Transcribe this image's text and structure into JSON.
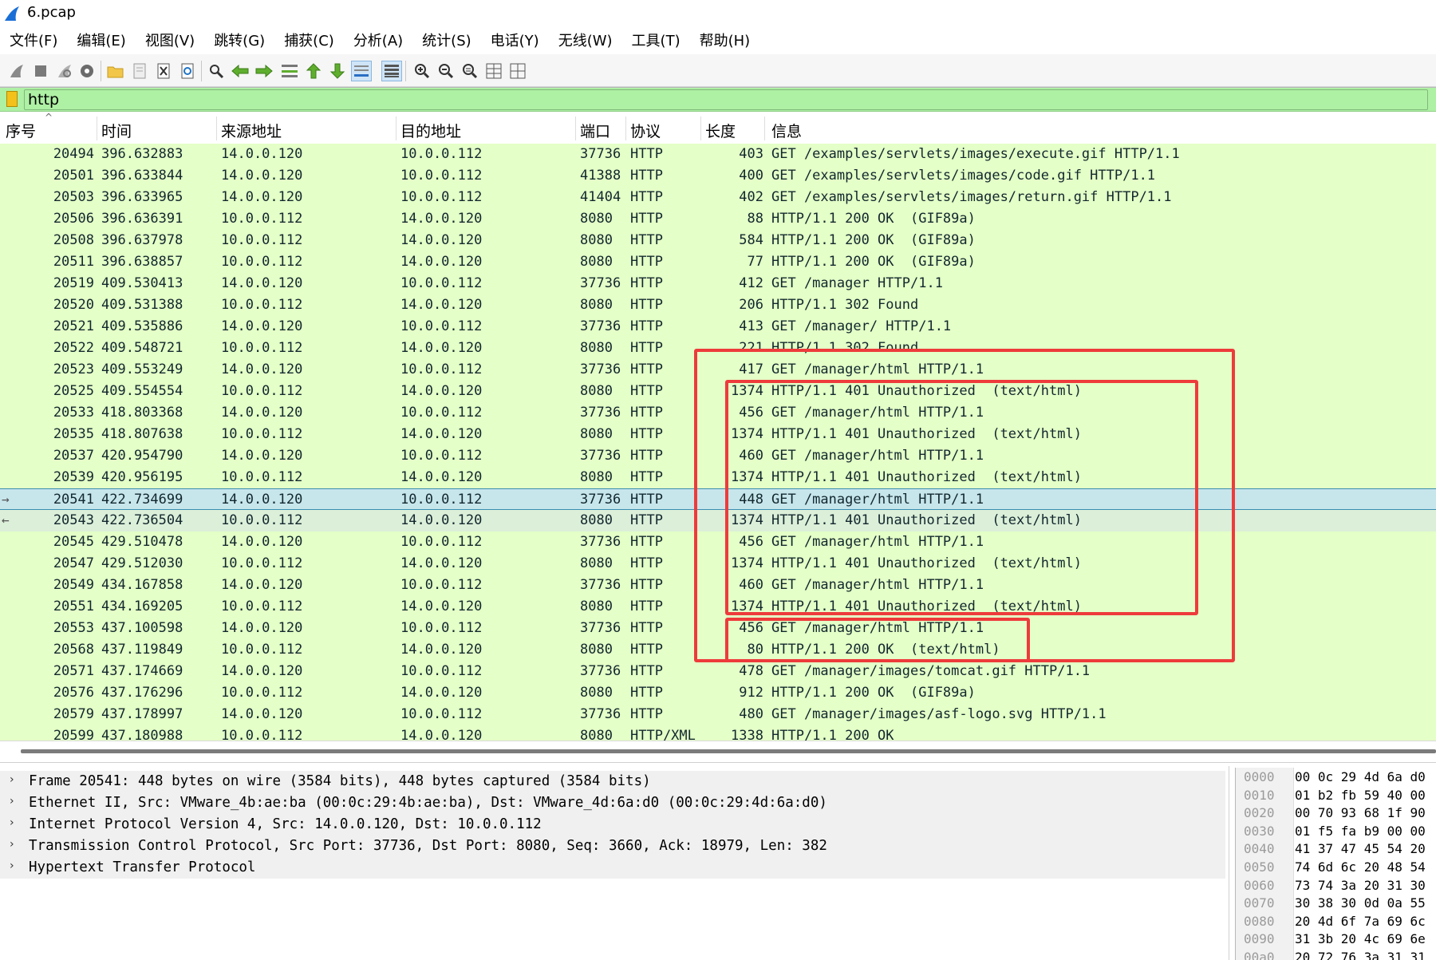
{
  "window": {
    "title": "6.pcap",
    "icon": "wireshark-fin-icon"
  },
  "menu": [
    "文件(F)",
    "编辑(E)",
    "视图(V)",
    "跳转(G)",
    "捕获(C)",
    "分析(A)",
    "统计(S)",
    "电话(Y)",
    "无线(W)",
    "工具(T)",
    "帮助(H)"
  ],
  "toolbar": {
    "icons": [
      "start-capture-icon",
      "stop-capture-icon",
      "restart-capture-icon",
      "capture-options-icon",
      "open-file-icon",
      "save-file-icon",
      "close-file-icon",
      "reload-file-icon",
      "find-packet-icon",
      "go-back-icon",
      "go-forward-icon",
      "go-to-packet-icon",
      "first-packet-icon",
      "last-packet-icon",
      "autoscroll-icon",
      "colorize-icon",
      "zoom-in-icon",
      "zoom-out-icon",
      "normal-size-icon",
      "resize-columns-icon",
      "layout-icon"
    ]
  },
  "filter": {
    "value": "http"
  },
  "columns": [
    "序号",
    "时间",
    "来源地址",
    "目的地址",
    "端口",
    "协议",
    "长度",
    "信息"
  ],
  "packets": [
    {
      "no": "20494",
      "time": "396.632883",
      "src": "14.0.0.120",
      "dst": "10.0.0.112",
      "port": "37736",
      "proto": "HTTP",
      "len": "403",
      "info": "GET /examples/servlets/images/execute.gif HTTP/1.1"
    },
    {
      "no": "20501",
      "time": "396.633844",
      "src": "14.0.0.120",
      "dst": "10.0.0.112",
      "port": "41388",
      "proto": "HTTP",
      "len": "400",
      "info": "GET /examples/servlets/images/code.gif HTTP/1.1"
    },
    {
      "no": "20503",
      "time": "396.633965",
      "src": "14.0.0.120",
      "dst": "10.0.0.112",
      "port": "41404",
      "proto": "HTTP",
      "len": "402",
      "info": "GET /examples/servlets/images/return.gif HTTP/1.1"
    },
    {
      "no": "20506",
      "time": "396.636391",
      "src": "10.0.0.112",
      "dst": "14.0.0.120",
      "port": "8080",
      "proto": "HTTP",
      "len": "88",
      "info": "HTTP/1.1 200 OK  (GIF89a)"
    },
    {
      "no": "20508",
      "time": "396.637978",
      "src": "10.0.0.112",
      "dst": "14.0.0.120",
      "port": "8080",
      "proto": "HTTP",
      "len": "584",
      "info": "HTTP/1.1 200 OK  (GIF89a)"
    },
    {
      "no": "20511",
      "time": "396.638857",
      "src": "10.0.0.112",
      "dst": "14.0.0.120",
      "port": "8080",
      "proto": "HTTP",
      "len": "77",
      "info": "HTTP/1.1 200 OK  (GIF89a)"
    },
    {
      "no": "20519",
      "time": "409.530413",
      "src": "14.0.0.120",
      "dst": "10.0.0.112",
      "port": "37736",
      "proto": "HTTP",
      "len": "412",
      "info": "GET /manager HTTP/1.1"
    },
    {
      "no": "20520",
      "time": "409.531388",
      "src": "10.0.0.112",
      "dst": "14.0.0.120",
      "port": "8080",
      "proto": "HTTP",
      "len": "206",
      "info": "HTTP/1.1 302 Found"
    },
    {
      "no": "20521",
      "time": "409.535886",
      "src": "14.0.0.120",
      "dst": "10.0.0.112",
      "port": "37736",
      "proto": "HTTP",
      "len": "413",
      "info": "GET /manager/ HTTP/1.1"
    },
    {
      "no": "20522",
      "time": "409.548721",
      "src": "10.0.0.112",
      "dst": "14.0.0.120",
      "port": "8080",
      "proto": "HTTP",
      "len": "221",
      "info": "HTTP/1.1 302 Found"
    },
    {
      "no": "20523",
      "time": "409.553249",
      "src": "14.0.0.120",
      "dst": "10.0.0.112",
      "port": "37736",
      "proto": "HTTP",
      "len": "417",
      "info": "GET /manager/html HTTP/1.1"
    },
    {
      "no": "20525",
      "time": "409.554554",
      "src": "10.0.0.112",
      "dst": "14.0.0.120",
      "port": "8080",
      "proto": "HTTP",
      "len": "1374",
      "info": "HTTP/1.1 401 Unauthorized  (text/html)"
    },
    {
      "no": "20533",
      "time": "418.803368",
      "src": "14.0.0.120",
      "dst": "10.0.0.112",
      "port": "37736",
      "proto": "HTTP",
      "len": "456",
      "info": "GET /manager/html HTTP/1.1"
    },
    {
      "no": "20535",
      "time": "418.807638",
      "src": "10.0.0.112",
      "dst": "14.0.0.120",
      "port": "8080",
      "proto": "HTTP",
      "len": "1374",
      "info": "HTTP/1.1 401 Unauthorized  (text/html)"
    },
    {
      "no": "20537",
      "time": "420.954790",
      "src": "14.0.0.120",
      "dst": "10.0.0.112",
      "port": "37736",
      "proto": "HTTP",
      "len": "460",
      "info": "GET /manager/html HTTP/1.1"
    },
    {
      "no": "20539",
      "time": "420.956195",
      "src": "10.0.0.112",
      "dst": "14.0.0.120",
      "port": "8080",
      "proto": "HTTP",
      "len": "1374",
      "info": "HTTP/1.1 401 Unauthorized  (text/html)"
    },
    {
      "no": "20541",
      "time": "422.734699",
      "src": "14.0.0.120",
      "dst": "10.0.0.112",
      "port": "37736",
      "proto": "HTTP",
      "len": "448",
      "info": "GET /manager/html HTTP/1.1",
      "state": "selected",
      "mark": "→"
    },
    {
      "no": "20543",
      "time": "422.736504",
      "src": "10.0.0.112",
      "dst": "14.0.0.120",
      "port": "8080",
      "proto": "HTTP",
      "len": "1374",
      "info": "HTTP/1.1 401 Unauthorized  (text/html)",
      "state": "related",
      "mark": "←"
    },
    {
      "no": "20545",
      "time": "429.510478",
      "src": "14.0.0.120",
      "dst": "10.0.0.112",
      "port": "37736",
      "proto": "HTTP",
      "len": "456",
      "info": "GET /manager/html HTTP/1.1"
    },
    {
      "no": "20547",
      "time": "429.512030",
      "src": "10.0.0.112",
      "dst": "14.0.0.120",
      "port": "8080",
      "proto": "HTTP",
      "len": "1374",
      "info": "HTTP/1.1 401 Unauthorized  (text/html)"
    },
    {
      "no": "20549",
      "time": "434.167858",
      "src": "14.0.0.120",
      "dst": "10.0.0.112",
      "port": "37736",
      "proto": "HTTP",
      "len": "460",
      "info": "GET /manager/html HTTP/1.1"
    },
    {
      "no": "20551",
      "time": "434.169205",
      "src": "10.0.0.112",
      "dst": "14.0.0.120",
      "port": "8080",
      "proto": "HTTP",
      "len": "1374",
      "info": "HTTP/1.1 401 Unauthorized  (text/html)"
    },
    {
      "no": "20553",
      "time": "437.100598",
      "src": "14.0.0.120",
      "dst": "10.0.0.112",
      "port": "37736",
      "proto": "HTTP",
      "len": "456",
      "info": "GET /manager/html HTTP/1.1"
    },
    {
      "no": "20568",
      "time": "437.119849",
      "src": "10.0.0.112",
      "dst": "14.0.0.120",
      "port": "8080",
      "proto": "HTTP",
      "len": "80",
      "info": "HTTP/1.1 200 OK  (text/html)"
    },
    {
      "no": "20571",
      "time": "437.174669",
      "src": "14.0.0.120",
      "dst": "10.0.0.112",
      "port": "37736",
      "proto": "HTTP",
      "len": "478",
      "info": "GET /manager/images/tomcat.gif HTTP/1.1"
    },
    {
      "no": "20576",
      "time": "437.176296",
      "src": "10.0.0.112",
      "dst": "14.0.0.120",
      "port": "8080",
      "proto": "HTTP",
      "len": "912",
      "info": "HTTP/1.1 200 OK  (GIF89a)"
    },
    {
      "no": "20579",
      "time": "437.178997",
      "src": "14.0.0.120",
      "dst": "10.0.0.112",
      "port": "37736",
      "proto": "HTTP",
      "len": "480",
      "info": "GET /manager/images/asf-logo.svg HTTP/1.1"
    },
    {
      "no": "20599",
      "time": "437.180988",
      "src": "10.0.0.112",
      "dst": "14.0.0.120",
      "port": "8080",
      "proto": "HTTP/XML",
      "len": "1338",
      "info": "HTTP/1.1 200 OK"
    }
  ],
  "details": [
    "Frame 20541: 448 bytes on wire (3584 bits), 448 bytes captured (3584 bits)",
    "Ethernet II, Src: VMware_4b:ae:ba (00:0c:29:4b:ae:ba), Dst: VMware_4d:6a:d0 (00:0c:29:4d:6a:d0)",
    "Internet Protocol Version 4, Src: 14.0.0.120, Dst: 10.0.0.112",
    "Transmission Control Protocol, Src Port: 37736, Dst Port: 8080, Seq: 3660, Ack: 18979, Len: 382",
    "Hypertext Transfer Protocol"
  ],
  "hex": [
    {
      "offset": "0000",
      "bytes": "00 0c 29 4d 6a d0"
    },
    {
      "offset": "0010",
      "bytes": "01 b2 fb 59 40 00"
    },
    {
      "offset": "0020",
      "bytes": "00 70 93 68 1f 90"
    },
    {
      "offset": "0030",
      "bytes": "01 f5 fa b9 00 00"
    },
    {
      "offset": "0040",
      "bytes": "41 37 47 45 54 20"
    },
    {
      "offset": "0050",
      "bytes": "74 6d 6c 20 48 54"
    },
    {
      "offset": "0060",
      "bytes": "73 74 3a 20 31 30"
    },
    {
      "offset": "0070",
      "bytes": "30 38 30 0d 0a 55"
    },
    {
      "offset": "0080",
      "bytes": "20 4d 6f 7a 69 6c"
    },
    {
      "offset": "0090",
      "bytes": "31 3b 20 4c 69 6e"
    },
    {
      "offset": "00a0",
      "bytes": "20 72 76 3a 31 31"
    }
  ],
  "colors": {
    "packet_row_bg": "#e4ffc7",
    "selected_row_bg": "#c7e6ec",
    "filter_bg": "#aef0a4",
    "annotation_red": "#ee3b3b"
  }
}
